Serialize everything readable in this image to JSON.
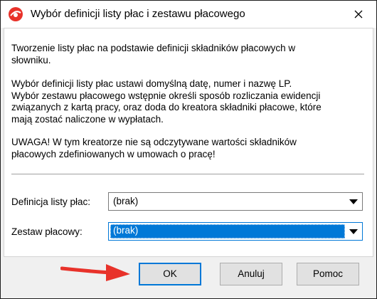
{
  "window": {
    "title": "Wybór definicji listy płac i zestawu płacowego",
    "icons": {
      "app": "app-logo-icon",
      "close": "close-icon"
    }
  },
  "content": {
    "paragraph1": "Tworzenie listy płac na podstawie definicji składników płacowych w\nsłowniku.",
    "paragraph2": "Wybór definicji listy płac ustawi domyślną datę, numer i nazwę LP.\nWybór zestawu płacowego wstępnie określi sposób rozliczania ewidencji\nzwiązanych z kartą pracy, oraz doda do kreatora składniki płacowe, które\nmają zostać naliczone w wypłatach.",
    "paragraph3": "UWAGA! W tym kreatorze nie są odczytywane wartości składników\npłacowych zdefiniowanych w umowach o pracę!"
  },
  "fields": {
    "definicja_label": "Definicja listy płac:",
    "definicja_value": "(brak)",
    "zestaw_label": "Zestaw płacowy:",
    "zestaw_value": "(brak)"
  },
  "buttons": {
    "ok": "OK",
    "cancel": "Anuluj",
    "help": "Pomoc"
  },
  "colors": {
    "accent": "#0078d7",
    "annotation_arrow": "#e8322a"
  }
}
